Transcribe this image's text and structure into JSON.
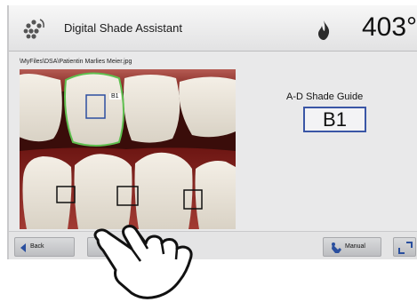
{
  "header": {
    "app_icon": "teeth-dots-icon",
    "title": "Digital Shade Assistant",
    "flame_icon": "flame-icon",
    "temperature": "403°"
  },
  "file_path": "\\MyFiles\\DSA\\Patientin Marlies Meier.jpg",
  "photo": {
    "tooth_label": "B1"
  },
  "shade_guide": {
    "title": "A-D Shade Guide",
    "value": "B1"
  },
  "footer": {
    "back_label": "Back",
    "manual_label": "Manual",
    "manual_icon": "hand-tool-icon",
    "expand_icon": "expand-icon"
  },
  "overlay": {
    "pointer": "pointing-hand-icon"
  }
}
